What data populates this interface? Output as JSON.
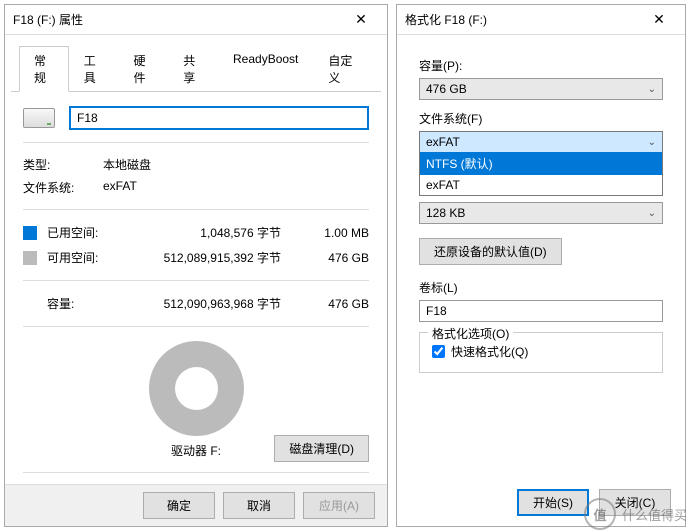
{
  "properties": {
    "title": "F18 (F:) 属性",
    "tabs": [
      "常规",
      "工具",
      "硬件",
      "共享",
      "ReadyBoost",
      "自定义"
    ],
    "drive_name": "F18",
    "type_label": "类型:",
    "type_value": "本地磁盘",
    "fs_label": "文件系统:",
    "fs_value": "exFAT",
    "used_label": "已用空间:",
    "used_bytes": "1,048,576 字节",
    "used_human": "1.00 MB",
    "free_label": "可用空间:",
    "free_bytes": "512,089,915,392 字节",
    "free_human": "476 GB",
    "capacity_label": "容量:",
    "capacity_bytes": "512,090,963,968 字节",
    "capacity_human": "476 GB",
    "drive_caption": "驱动器 F:",
    "cleanup": "磁盘清理(D)",
    "ok": "确定",
    "cancel": "取消",
    "apply": "应用(A)"
  },
  "format": {
    "title": "格式化 F18 (F:)",
    "capacity_label": "容量(P):",
    "capacity_value": "476 GB",
    "fs_label": "文件系统(F)",
    "fs_selected": "exFAT",
    "fs_options": [
      "NTFS (默认)",
      "exFAT"
    ],
    "alloc_value": "128 KB",
    "restore": "还原设备的默认值(D)",
    "volume_label": "卷标(L)",
    "volume_value": "F18",
    "options_label": "格式化选项(O)",
    "quick_label": "快速格式化(Q)",
    "start": "开始(S)",
    "close": "关闭(C)"
  },
  "watermark": "什么值得买"
}
